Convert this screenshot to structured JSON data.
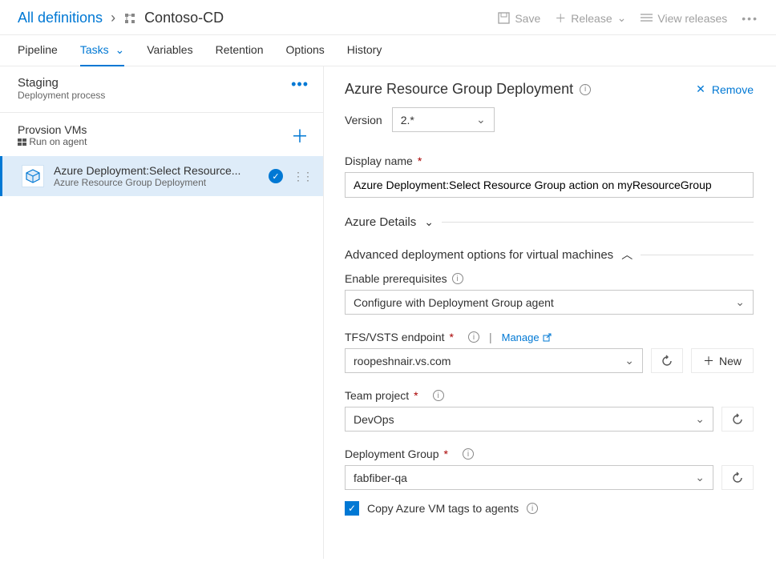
{
  "breadcrumb": {
    "all_defs": "All definitions",
    "pipeline_name": "Contoso-CD"
  },
  "actions": {
    "save": "Save",
    "release": "Release",
    "view_releases": "View releases"
  },
  "tabs": [
    "Pipeline",
    "Tasks",
    "Variables",
    "Retention",
    "Options",
    "History"
  ],
  "stage": {
    "name": "Staging",
    "subtitle": "Deployment process"
  },
  "job": {
    "name": "Provsion VMs",
    "agent": "Run on agent"
  },
  "task": {
    "title": "Azure Deployment:Select Resource...",
    "subtitle": "Azure Resource Group Deployment"
  },
  "panel": {
    "title": "Azure Resource Group Deployment",
    "remove": "Remove",
    "version_label": "Version",
    "version_value": "2.*",
    "display_name_label": "Display name",
    "display_name_value": "Azure Deployment:Select Resource Group action on myResourceGroup",
    "section_azure_details": "Azure Details",
    "section_advanced": "Advanced deployment options for virtual machines",
    "enable_prereq_label": "Enable prerequisites",
    "enable_prereq_value": "Configure with Deployment Group agent",
    "endpoint_label": "TFS/VSTS endpoint",
    "endpoint_manage": "Manage",
    "endpoint_value": "roopeshnair.vs.com",
    "endpoint_new": "New",
    "team_project_label": "Team project",
    "team_project_value": "DevOps",
    "deployment_group_label": "Deployment Group",
    "deployment_group_value": "fabfiber-qa",
    "copy_tags_label": "Copy Azure VM tags to agents"
  }
}
